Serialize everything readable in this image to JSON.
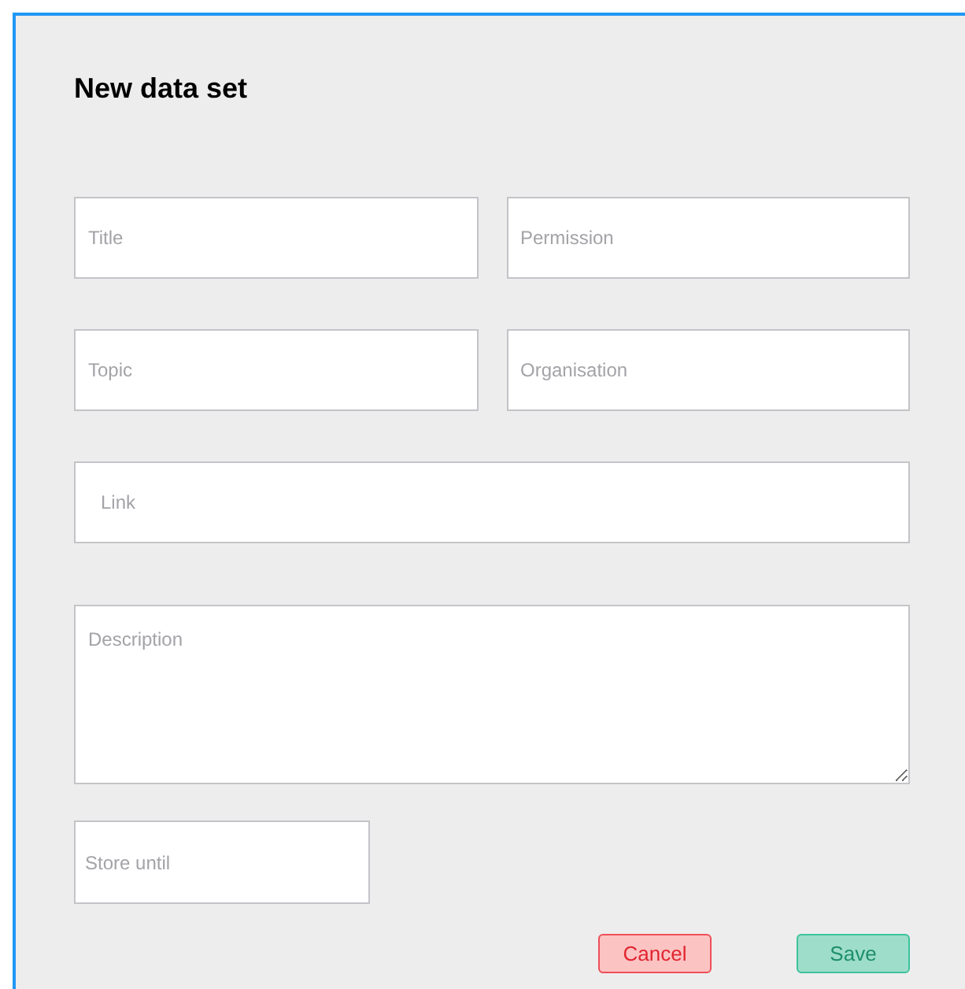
{
  "dialog": {
    "title": "New data set",
    "rows": [
      {
        "fields": [
          {
            "kind": "input",
            "placeholder": "Title"
          },
          {
            "kind": "input",
            "placeholder": "Permission"
          }
        ]
      },
      {
        "fields": [
          {
            "kind": "input",
            "placeholder": "Topic"
          },
          {
            "kind": "input",
            "placeholder": "Organisation"
          }
        ]
      },
      {
        "fields": [
          {
            "kind": "link",
            "placeholder": "Link"
          }
        ]
      },
      {
        "fields": [
          {
            "kind": "textarea",
            "placeholder": "Description"
          }
        ]
      },
      {
        "fields": [
          {
            "kind": "date",
            "placeholder": "Store until"
          }
        ]
      }
    ],
    "buttons": [
      {
        "kind": "cancel",
        "label": "Cancel"
      },
      {
        "kind": "save",
        "label": "Save"
      }
    ]
  }
}
